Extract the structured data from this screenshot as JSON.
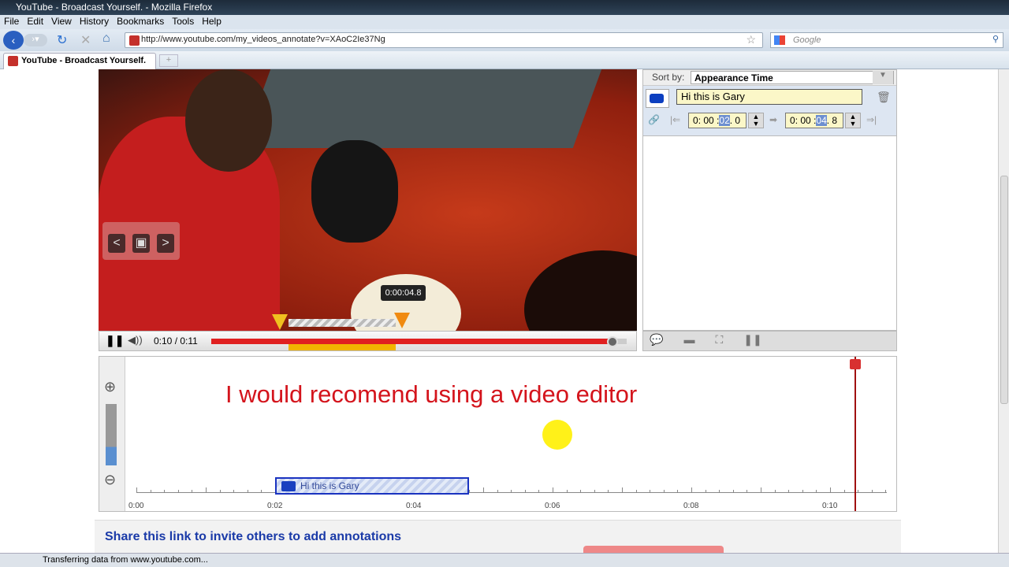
{
  "window": {
    "title": "YouTube - Broadcast Yourself. - Mozilla Firefox"
  },
  "menu": [
    "File",
    "Edit",
    "View",
    "History",
    "Bookmarks",
    "Tools",
    "Help"
  ],
  "nav": {
    "url": "http://www.youtube.com/my_videos_annotate?v=XAoC2Ie37Ng",
    "search_placeholder": "Google"
  },
  "tab": {
    "label": "YouTube - Broadcast Yourself.",
    "new_tab": "+"
  },
  "player": {
    "marker_tooltip": "0:00:04.8",
    "time": "0:10 / 0:11",
    "progress_percent": 97,
    "nav_prev": "<",
    "nav_next": ">"
  },
  "side": {
    "sort_label": "Sort by:",
    "sort_value": "Appearance Time",
    "annotation_text": "Hi this is Gary",
    "start": {
      "h": "0",
      "m": "00",
      "s": "02",
      "f": "0"
    },
    "end": {
      "h": "0",
      "m": "00",
      "s": "04",
      "f": "8"
    }
  },
  "timeline": {
    "overlay_text": "I would recomend using a video editor",
    "annotation_label": "Hi this is Gary",
    "labels": [
      "0:00",
      "0:02",
      "0:04",
      "0:06",
      "0:08",
      "0:10"
    ],
    "annotation_start_s": 2.0,
    "annotation_end_s": 4.8,
    "playhead_s": 10.35
  },
  "share": {
    "title": "Share this link to invite others to add annotations"
  },
  "status": {
    "text": "Transferring data from www.youtube.com..."
  }
}
